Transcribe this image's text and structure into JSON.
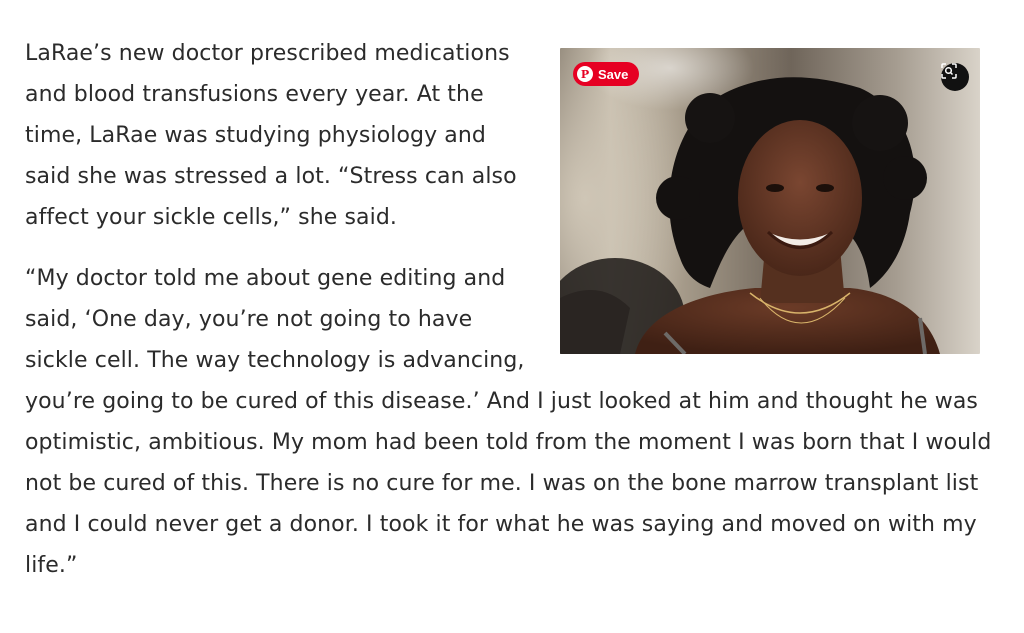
{
  "paragraphs": [
    "LaRae’s new doctor prescribed medications and blood transfusions every year. At the time, LaRae was studying physiology and said she was stressed a lot. “Stress can also affect your sickle cells,” she said.",
    "“My doctor told me about gene editing and said, ‘One day, you’re not going to have sickle cell. The way technology is advancing, you’re going to be cured of this disease.’ And I just looked at him and thought he was optimistic, ambitious. My mom had been told from the moment I was born that I would not be cured of this. There is no cure for me. I was on the bone marrow transplant list and I could never get a donor. I took it for what he was saying and moved on with my life.”"
  ],
  "image": {
    "save_label": "Save",
    "save_icon": "pinterest-logo-icon",
    "lens_icon": "visual-search-icon",
    "brand_color": "#e60023"
  }
}
